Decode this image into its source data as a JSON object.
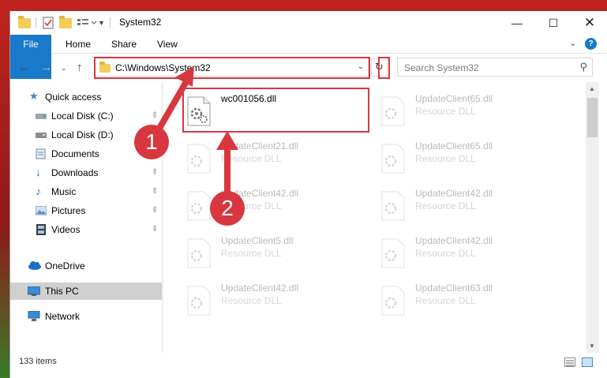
{
  "window": {
    "title": "System32"
  },
  "ribbon": {
    "tabs": [
      "File",
      "Home",
      "Share",
      "View"
    ]
  },
  "address": {
    "path": "C:\\Windows\\System32"
  },
  "search": {
    "placeholder": "Search System32"
  },
  "sidebar": {
    "items": [
      {
        "label": "Quick access",
        "icon": "star-icon",
        "pinned": false
      },
      {
        "label": "Local Disk (C:)",
        "icon": "drive-icon",
        "pinned": true
      },
      {
        "label": "Local Disk (D:)",
        "icon": "drive-icon",
        "pinned": false
      },
      {
        "label": "Documents",
        "icon": "documents-icon",
        "pinned": true
      },
      {
        "label": "Downloads",
        "icon": "download-icon",
        "pinned": true
      },
      {
        "label": "Music",
        "icon": "music-icon",
        "pinned": true
      },
      {
        "label": "Pictures",
        "icon": "pictures-icon",
        "pinned": true
      },
      {
        "label": "Videos",
        "icon": "videos-icon",
        "pinned": true
      },
      {
        "label": "OneDrive",
        "icon": "cloud-icon",
        "pinned": false
      },
      {
        "label": "This PC",
        "icon": "computer-icon",
        "pinned": false,
        "selected": true
      },
      {
        "label": "Network",
        "icon": "network-icon",
        "pinned": false
      }
    ]
  },
  "files": [
    {
      "name": "wc001056.dll",
      "type": "",
      "faded": false
    },
    {
      "name": "UpdateClient65.dll",
      "type": "Resource DLL",
      "faded": true
    },
    {
      "name": "UpdateClient21.dll",
      "type": "Resource DLL",
      "faded": true
    },
    {
      "name": "UpdateClient65.dll",
      "type": "Resource DLL",
      "faded": true
    },
    {
      "name": "UpdateClient42.dll",
      "type": "Resource DLL",
      "faded": true
    },
    {
      "name": "UpdateClient42.dll",
      "type": "Resource DLL",
      "faded": true
    },
    {
      "name": "UpdateClient5.dll",
      "type": "Resource DLL",
      "faded": true
    },
    {
      "name": "UpdateClient42.dll",
      "type": "Resource DLL",
      "faded": true
    },
    {
      "name": "UpdateClient42.dll",
      "type": "Resource DLL",
      "faded": true
    },
    {
      "name": "UpdateClient63.dll",
      "type": "Resource DLL",
      "faded": true
    }
  ],
  "status": {
    "count": "133 items"
  },
  "annotations": {
    "step1": "1",
    "step2": "2",
    "color": "#d8373f"
  },
  "colors": {
    "accent": "#1979ca",
    "selection": "#d0d0d0"
  }
}
